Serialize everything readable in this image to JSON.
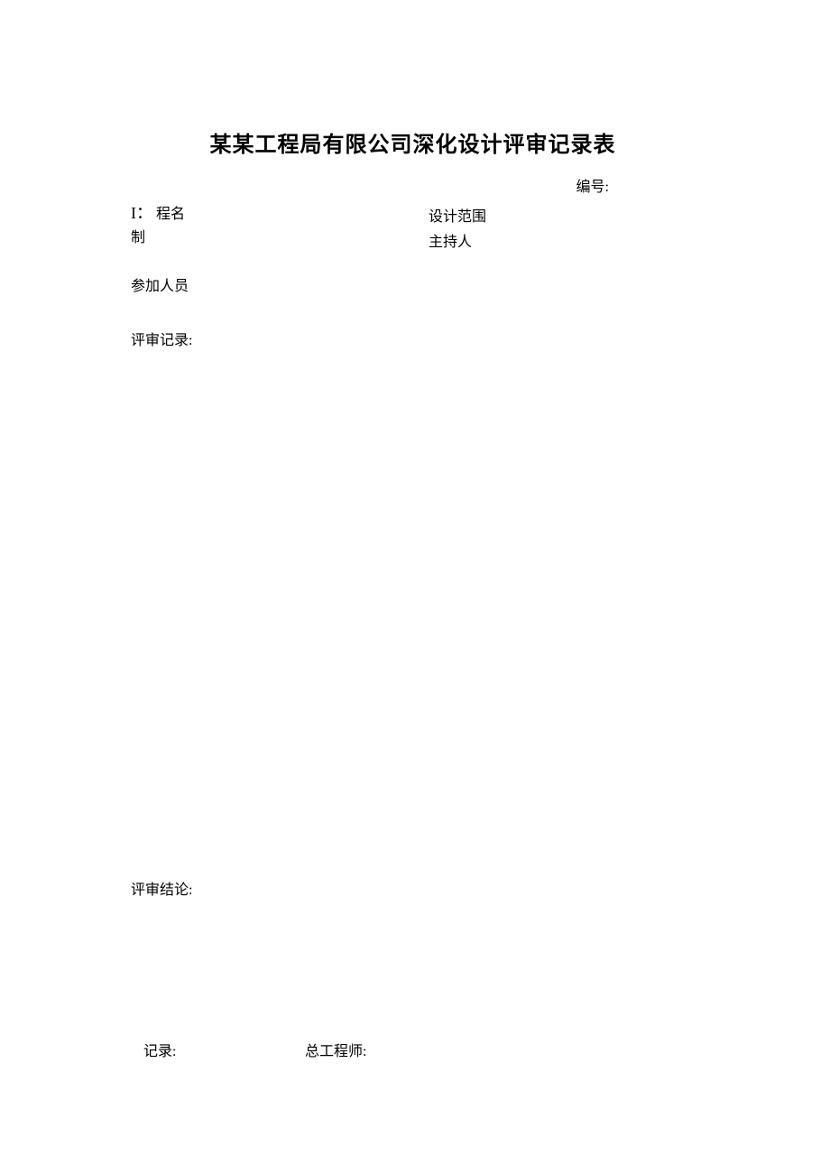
{
  "title": "某某工程局有限公司深化设计评审记录表",
  "serial_label": "编号:",
  "header": {
    "left_line1_prefix": "I：",
    "left_line1_text": "程名",
    "left_line2": "制",
    "right_line1": "设计范围",
    "right_line2": "主持人"
  },
  "participants_label": "参加人员",
  "review_record_label": "评审记录:",
  "conclusion_label": "评审结论:",
  "signature": {
    "record_label": "记录:",
    "engineer_label": "总工程师:"
  }
}
